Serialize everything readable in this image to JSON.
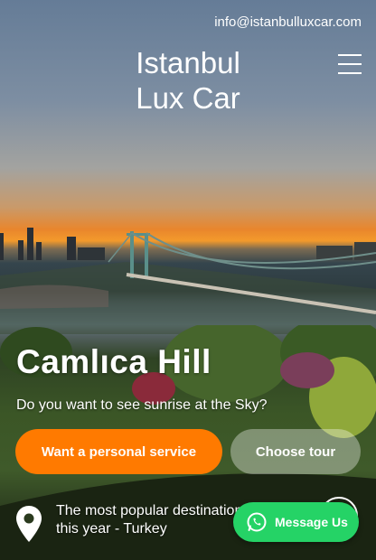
{
  "header": {
    "email": "info@istanbulluxcar.com",
    "brand_line1": "Istanbul",
    "brand_line2": "Lux Car"
  },
  "hero": {
    "title": "Camlıca Hill",
    "subtitle": "Do you want to see sunrise at the Sky?",
    "primary_button": "Want a personal service",
    "secondary_button": "Choose tour",
    "destination_line1": "The most popular destination",
    "destination_line2": "this year - Turkey"
  },
  "whatsapp": {
    "label": "Message Us"
  },
  "colors": {
    "accent_orange": "#ff7a00",
    "whatsapp_green": "#25d366"
  },
  "icons": {
    "menu": "hamburger-menu-icon",
    "pin": "location-pin-icon",
    "whatsapp": "whatsapp-icon"
  }
}
